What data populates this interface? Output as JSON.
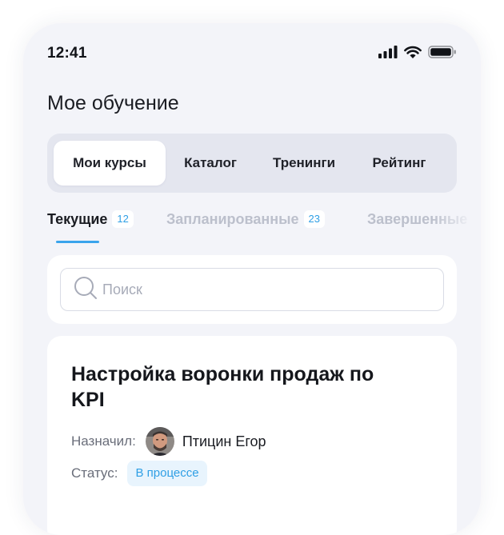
{
  "status_bar": {
    "time": "12:41",
    "icons": [
      "cellular-signal-icon",
      "wifi-icon",
      "battery-icon"
    ]
  },
  "page": {
    "title": "Мое обучение"
  },
  "segments": [
    {
      "label": "Мои курсы",
      "active": true
    },
    {
      "label": "Каталог",
      "active": false
    },
    {
      "label": "Тренинги",
      "active": false
    },
    {
      "label": "Рейтинг",
      "active": false
    }
  ],
  "subtabs": [
    {
      "label": "Текущие",
      "count": "12",
      "active": true
    },
    {
      "label": "Запланированные",
      "count": "23",
      "active": false
    },
    {
      "label": "Завершенные",
      "count": "",
      "active": false
    }
  ],
  "search": {
    "placeholder": "Поиск",
    "value": ""
  },
  "course": {
    "title": "Настройка воронки продаж по KPI",
    "assigned_label": "Назначил:",
    "assigned_name": "Птицин Егор",
    "status_label": "Статус:",
    "status_value": "В процессе"
  },
  "colors": {
    "accent": "#3aa4ec",
    "background": "#f3f4f9",
    "segment_bg": "#e4e6ef",
    "status_badge_bg": "#e8f4fd"
  }
}
